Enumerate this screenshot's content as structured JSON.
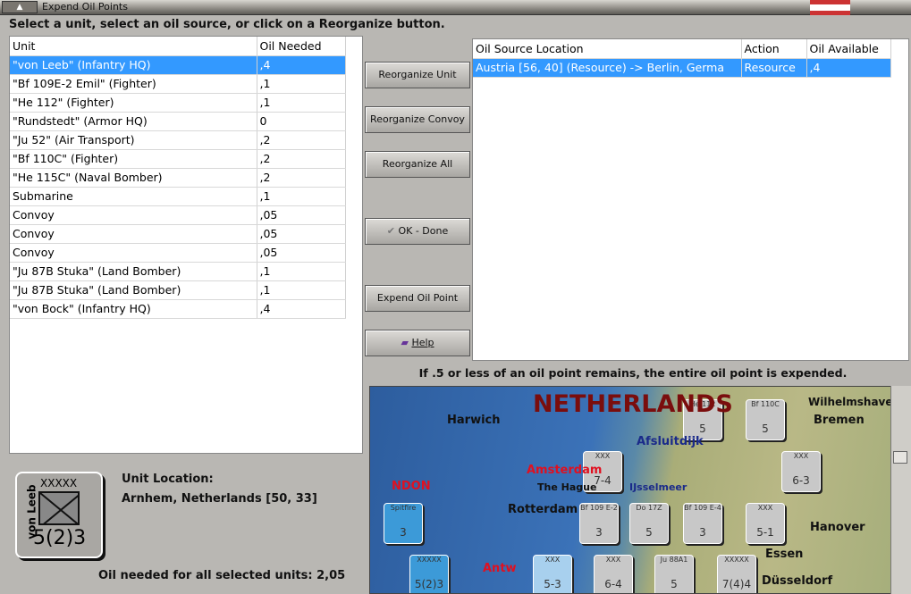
{
  "window": {
    "title": "Expend Oil Points"
  },
  "instruction": "Select a unit, select an oil source, or click on a Reorganize button.",
  "unit_table": {
    "headers": [
      "Unit",
      "Oil Needed"
    ],
    "rows": [
      [
        "\"von Leeb\" (Infantry HQ)",
        ",4"
      ],
      [
        "\"Bf 109E-2 Emil\" (Fighter)",
        ",1"
      ],
      [
        "\"He 112\" (Fighter)",
        ",1"
      ],
      [
        "\"Rundstedt\" (Armor HQ)",
        "0"
      ],
      [
        "\"Ju 52\" (Air Transport)",
        ",2"
      ],
      [
        "\"Bf 110C\" (Fighter)",
        ",2"
      ],
      [
        "\"He 115C\" (Naval Bomber)",
        ",2"
      ],
      [
        "Submarine",
        ",1"
      ],
      [
        "Convoy",
        ",05"
      ],
      [
        "Convoy",
        ",05"
      ],
      [
        "Convoy",
        ",05"
      ],
      [
        "\"Ju 87B Stuka\" (Land Bomber)",
        ",1"
      ],
      [
        "\"Ju 87B Stuka\" (Land Bomber)",
        ",1"
      ],
      [
        "\"von Bock\" (Infantry HQ)",
        ",4"
      ]
    ]
  },
  "buttons": {
    "reorganize_unit": "Reorganize Unit",
    "reorganize_convoy": "Reorganize Convoy",
    "reorganize_all": "Reorganize All",
    "ok_done": "OK - Done",
    "expend": "Expend Oil Point",
    "help": "Help"
  },
  "oil_table": {
    "headers": [
      "Oil Source Location",
      "Action",
      "Oil Available"
    ],
    "rows": [
      [
        "Austria [56, 40] (Resource) -> Berlin, Germa",
        "Resource",
        ",4"
      ]
    ]
  },
  "footer_note": "If .5 or less of an oil point remains, the entire oil point is expended.",
  "selected_unit": {
    "name": "von Leeb",
    "size": "XXXXX",
    "strength": "5(2)3",
    "location_label": "Unit Location:",
    "location": "Arnhem, Netherlands [50, 33]"
  },
  "oil_total": "Oil needed for all selected units:  2,05",
  "map": {
    "labels": [
      "NETHERLANDS",
      "Harwich",
      "Afsluitdijk",
      "Amsterdam",
      "The Hague",
      "IJsselmeer",
      "Rotterdam",
      "NDON",
      "Antw",
      "Bremen",
      "Wilhelmshaven",
      "Hanover",
      "Essen",
      "Düsseldorf"
    ],
    "counters": [
      {
        "name": "He 112",
        "value": "5"
      },
      {
        "name": "Bf 110C",
        "value": "5"
      },
      {
        "name": "XXX",
        "value": "7-4"
      },
      {
        "name": "XXX",
        "value": "6-3"
      },
      {
        "name": "Spitfire",
        "value": "3"
      },
      {
        "name": "Bf 109 E-2",
        "value": "3"
      },
      {
        "name": "Do 17Z",
        "value": "5"
      },
      {
        "name": "Bf 109 E-4",
        "value": "3"
      },
      {
        "name": "XXX",
        "value": "5-1"
      },
      {
        "name": "XXXXX",
        "value": "5(2)3"
      },
      {
        "name": "XXX",
        "value": "5-3"
      },
      {
        "name": "XXX",
        "value": "6-4"
      },
      {
        "name": "Ju 88A1",
        "value": "5"
      },
      {
        "name": "XXXXX",
        "value": "7(4)4"
      }
    ]
  }
}
